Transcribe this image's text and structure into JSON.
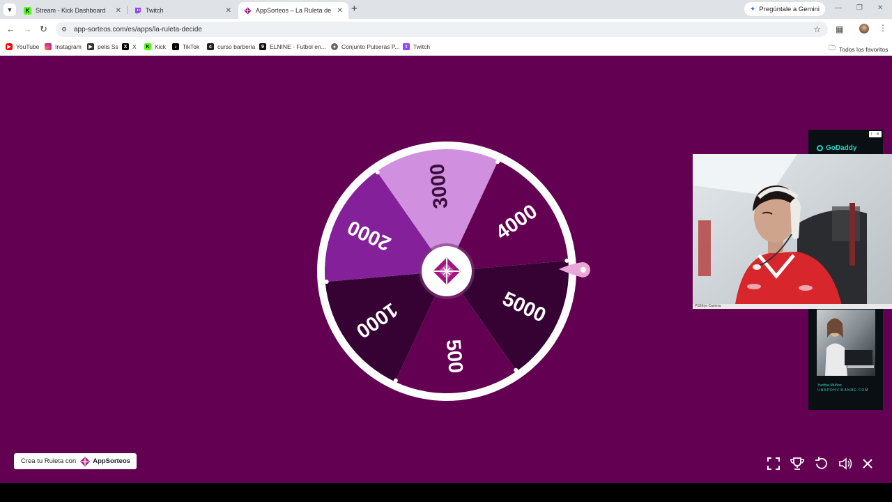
{
  "browser": {
    "tabs": [
      {
        "title": "Stream - Kick Dashboard",
        "favicon": "kick-icon",
        "active": false
      },
      {
        "title": "Twitch",
        "favicon": "twitch-icon",
        "active": false
      },
      {
        "title": "AppSorteos – La Ruleta de la Su",
        "favicon": "appsorteos-icon",
        "active": true
      }
    ],
    "gemini_label": "Pregúntale a Gemini",
    "url": "app-sorteos.com/es/apps/la-ruleta-decide",
    "bookmarks": [
      {
        "label": "YouTube",
        "icon": "youtube-icon"
      },
      {
        "label": "Instagram",
        "icon": "instagram-icon"
      },
      {
        "label": "pelis Ss",
        "icon": "play-icon"
      },
      {
        "label": "X",
        "icon": "x-icon"
      },
      {
        "label": "Kick",
        "icon": "kick-icon"
      },
      {
        "label": "TikTok",
        "icon": "tiktok-icon"
      },
      {
        "label": "curso barberia",
        "icon": "site-icon"
      },
      {
        "label": "ELNINE - Futbol en...",
        "icon": "elnine-icon"
      },
      {
        "label": "Conjunto Pulseras P...",
        "icon": "globe-icon"
      },
      {
        "label": "Twitch",
        "icon": "twitch-icon"
      }
    ],
    "all_favorites_label": "Todos los favoritos"
  },
  "wheel": {
    "segments": [
      {
        "label": "3000",
        "color": "#d08fdf"
      },
      {
        "label": "4000",
        "color": "#640052"
      },
      {
        "label": "5000",
        "color": "#360234"
      },
      {
        "label": "500",
        "color": "#640052"
      },
      {
        "label": "1000",
        "color": "#360234"
      },
      {
        "label": "2000",
        "color": "#83209a"
      }
    ],
    "rim_color": "#ffffff",
    "pointer_color": "#e9a6d6"
  },
  "ad": {
    "brand": "GoDaddy",
    "person_name": "Yuribia Muñoz",
    "site": "UNAPOHVIKANNE.COM"
  },
  "webcam": {
    "label": "PS3Eye Camera"
  },
  "credit": {
    "text": "Crea tu Ruleta con",
    "brand": "AppSorteos"
  },
  "controls": [
    "fullscreen-icon",
    "trophy-icon",
    "reset-icon",
    "volume-icon",
    "close-icon"
  ]
}
